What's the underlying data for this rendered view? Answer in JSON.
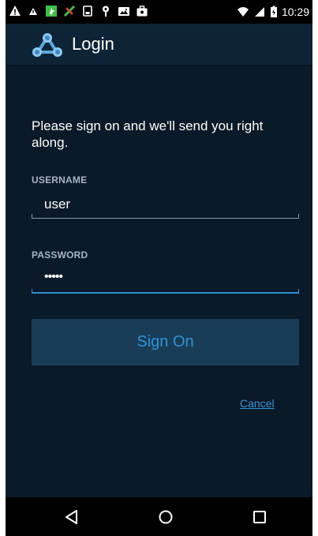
{
  "status_bar": {
    "time": "10:29",
    "left_icons": [
      "warning-icon",
      "warning-small-icon",
      "app-green-icon",
      "app-tools-icon",
      "sim-icon",
      "location-pin-icon",
      "photo-icon",
      "briefcase-icon"
    ],
    "right_icons": [
      "wifi-icon",
      "cellular-signal-icon",
      "battery-icon"
    ]
  },
  "action_bar": {
    "title": "Login",
    "logo_icon": "network-triangle-icon"
  },
  "login": {
    "intro": "Please sign on and we'll send you right along.",
    "username_label": "USERNAME",
    "username_value": "user",
    "password_label": "PASSWORD",
    "password_value": "•••••",
    "signon_label": "Sign On",
    "cancel_label": "Cancel"
  },
  "nav_bar": {
    "buttons": [
      "back-icon",
      "home-icon",
      "recents-icon"
    ]
  },
  "colors": {
    "background": "#0a1a28",
    "action_bar": "#0d2336",
    "accent": "#2f93d8",
    "button_bg": "#1a3d57",
    "label": "#a8b6c3"
  }
}
